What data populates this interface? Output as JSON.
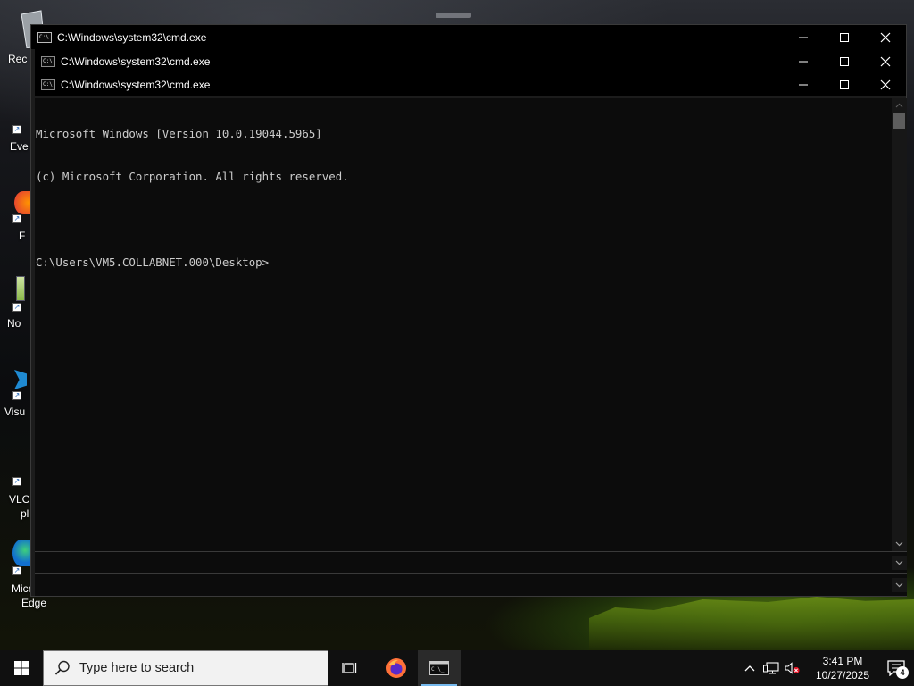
{
  "windows": {
    "main": {
      "title": "C:\\Windows\\system32\\cmd.exe"
    },
    "back1": {
      "title": "C:\\Windows\\system32\\cmd.exe"
    },
    "back2": {
      "title": "C:\\Windows\\system32\\cmd.exe"
    }
  },
  "console": {
    "lines": [
      "Microsoft Windows [Version 10.0.19044.5965]",
      "(c) Microsoft Corporation. All rights reserved.",
      "",
      "C:\\Users\\VM5.COLLABNET.000\\Desktop>"
    ]
  },
  "desktop": {
    "icons": [
      {
        "label": "Rec",
        "icon": "recycle-bin-icon"
      },
      {
        "label": "Eve",
        "icon": "shortcut-icon"
      },
      {
        "label": "F",
        "icon": "firefox-icon"
      },
      {
        "label": "No",
        "icon": "notepad-icon"
      },
      {
        "label": "Visu",
        "icon": "vscode-icon"
      },
      {
        "label": "VLC",
        "label2": "pl",
        "icon": "vlc-icon"
      },
      {
        "label": "Micr",
        "label2": "Edge",
        "icon": "edge-icon"
      }
    ]
  },
  "taskbar": {
    "search_placeholder": "Type here to search",
    "clock_time": "3:41 PM",
    "clock_date": "10/27/2025",
    "notification_count": "4",
    "apps": [
      {
        "name": "task-view",
        "icon": "task-view-icon"
      },
      {
        "name": "firefox",
        "icon": "firefox-icon"
      },
      {
        "name": "cmd",
        "icon": "cmd-icon",
        "active": true
      }
    ]
  },
  "colors": {
    "console_bg": "#0c0c0c",
    "console_text": "#cccccc",
    "taskbar_bg": "#101010",
    "active_indicator": "#76b9ed",
    "wallpaper_accent": "#6b8f16"
  }
}
